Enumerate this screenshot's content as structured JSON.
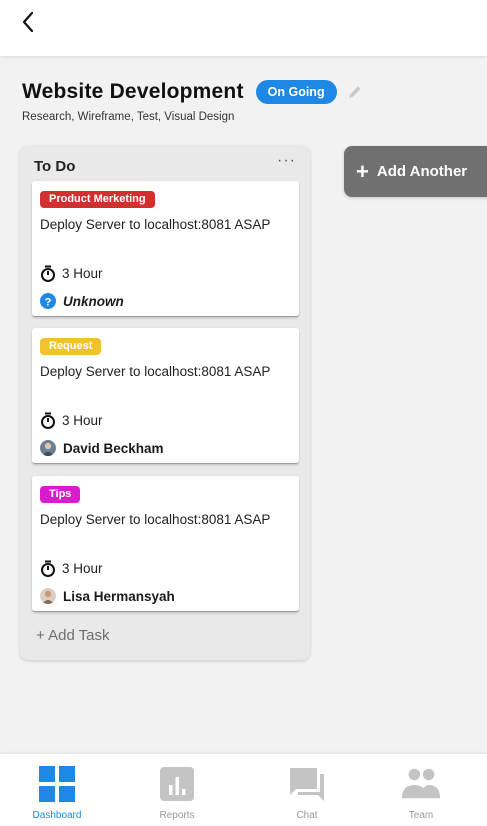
{
  "header": {
    "back_icon": "chevron-left-icon"
  },
  "project": {
    "title": "Website Development",
    "status": "On Going",
    "status_color": "#1e88e5",
    "subtitle": "Research, Wireframe, Test, Visual Design"
  },
  "column": {
    "title": "To Do",
    "more_label": "···",
    "add_task_label": "+ Add Task",
    "cards": [
      {
        "tag": "Product Merketing",
        "tag_color": "#d32f2f",
        "description": "Deploy Server to localhost:8081 ASAP",
        "hours": "3 Hour",
        "assignee": "Unknown"
      },
      {
        "tag": "Request",
        "tag_color": "#f2c12e",
        "description": "Deploy Server to localhost:8081 ASAP",
        "hours": "3 Hour",
        "assignee": "David Beckham"
      },
      {
        "tag": "Tips",
        "tag_color": "#d81bcf",
        "description": "Deploy Server to localhost:8081 ASAP",
        "hours": "3 Hour",
        "assignee": "Lisa Hermansyah"
      }
    ]
  },
  "add_list": {
    "label": "Add Another"
  },
  "nav": {
    "items": [
      {
        "label": "Dashboard",
        "icon": "dashboard-icon",
        "active": true
      },
      {
        "label": "Reports",
        "icon": "reports-icon",
        "active": false
      },
      {
        "label": "Chat",
        "icon": "chat-icon",
        "active": false
      },
      {
        "label": "Team",
        "icon": "team-icon",
        "active": false
      }
    ],
    "active_color": "#1e88e5",
    "inactive_color": "#c4c4c4"
  }
}
